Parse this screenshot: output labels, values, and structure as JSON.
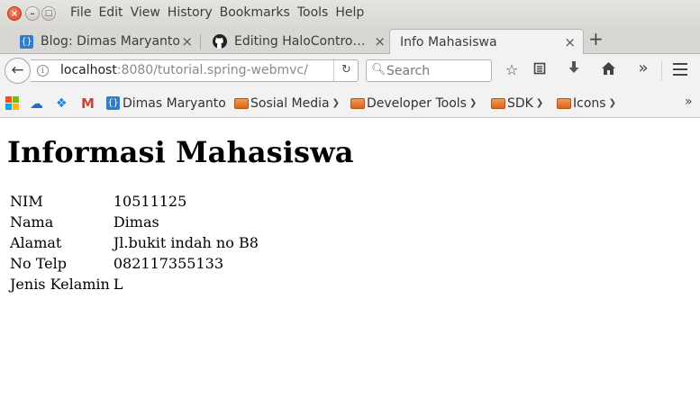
{
  "menu": [
    "File",
    "Edit",
    "View",
    "History",
    "Bookmarks",
    "Tools",
    "Help"
  ],
  "tabs": [
    {
      "label": "Blog: Dimas Maryanto",
      "icon": "brackets-icon",
      "active": false
    },
    {
      "label": "Editing HaloContro…",
      "icon": "github-icon",
      "active": false
    },
    {
      "label": "Info Mahasiswa",
      "icon": "",
      "active": true
    }
  ],
  "nav": {
    "url_host": "localhost",
    "url_rest": ":8080/tutorial.spring-webmvc/",
    "search_placeholder": "Search"
  },
  "bookmarks": [
    {
      "label": "",
      "icon": "microsoft-icon"
    },
    {
      "label": "",
      "icon": "onedrive-icon"
    },
    {
      "label": "",
      "icon": "dropbox-icon"
    },
    {
      "label": "",
      "icon": "gmail-icon"
    },
    {
      "label": "Dimas Maryanto",
      "icon": "brackets-icon"
    },
    {
      "label": "Sosial Media",
      "icon": "folder-icon"
    },
    {
      "label": "Developer Tools",
      "icon": "folder-icon"
    },
    {
      "label": "SDK",
      "icon": "folder-icon"
    },
    {
      "label": "Icons",
      "icon": "folder-icon"
    }
  ],
  "page": {
    "heading": "Informasi Mahasiswa",
    "rows": [
      {
        "key": "NIM",
        "value": "10511125"
      },
      {
        "key": "Nama",
        "value": "Dimas"
      },
      {
        "key": "Alamat",
        "value": "Jl.bukit indah no B8"
      },
      {
        "key": "No Telp",
        "value": "082117355133"
      },
      {
        "key": "Jenis Kelamin",
        "value": "L"
      }
    ]
  },
  "colors": {
    "chrome_bg": "#f2f2f2",
    "close_button": "#e0421b",
    "brackets_favicon": "#2d7dd2",
    "folder": "#e27a2e"
  }
}
